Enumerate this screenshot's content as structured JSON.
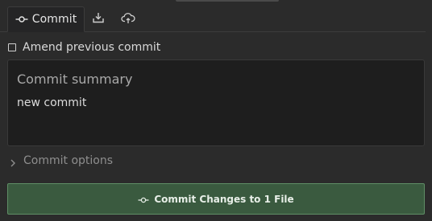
{
  "tabs": [
    {
      "label": "Commit",
      "icon": "commit-icon",
      "active": true
    },
    {
      "label": "",
      "icon": "download-icon",
      "active": false
    },
    {
      "label": "",
      "icon": "cloud-icon",
      "active": false
    }
  ],
  "amend": {
    "label": "Amend previous commit",
    "checked": false
  },
  "summary": {
    "placeholder": "Commit summary",
    "value": "",
    "description": "new commit"
  },
  "options": {
    "label": "Commit options",
    "icon": "chevron-right-icon"
  },
  "commit_button": {
    "label": "Commit Changes to 1 File",
    "icon": "commit-icon"
  },
  "colors": {
    "background": "#2b2b2b",
    "editor_background": "#1e1e1e",
    "button_background": "#3a5a3f",
    "button_border": "#5f8e66"
  }
}
